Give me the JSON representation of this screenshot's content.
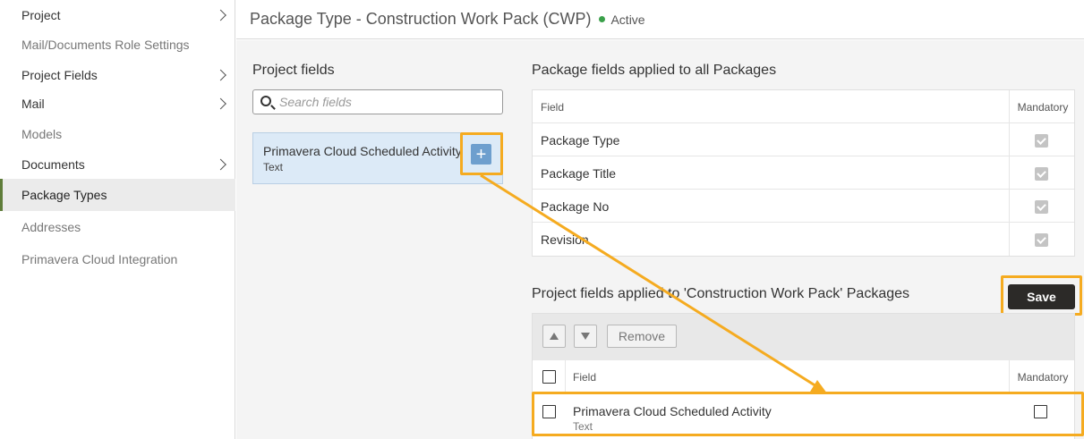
{
  "sidebar": {
    "items": [
      {
        "label": "Project",
        "chevron": true,
        "style": "dark"
      },
      {
        "label": "Mail/Documents Role Settings",
        "chevron": false,
        "style": "muted"
      },
      {
        "label": "Project Fields",
        "chevron": true,
        "style": "dark"
      },
      {
        "label": "Mail",
        "chevron": true,
        "style": "dark"
      },
      {
        "label": "Models",
        "chevron": false,
        "style": "muted"
      },
      {
        "label": "Documents",
        "chevron": true,
        "style": "dark"
      },
      {
        "label": "Package Types",
        "chevron": false,
        "style": "active"
      },
      {
        "label": "Addresses",
        "chevron": false,
        "style": "muted"
      },
      {
        "label": "Primavera Cloud Integration",
        "chevron": false,
        "style": "muted"
      }
    ]
  },
  "header": {
    "title": "Package Type - Construction Work Pack (CWP)",
    "status": "Active",
    "status_color": "#3aa04a"
  },
  "project_fields": {
    "title": "Project fields",
    "search_placeholder": "Search fields",
    "search_value": "",
    "items": [
      {
        "name": "Primavera Cloud Scheduled Activity",
        "type": "Text",
        "add_label": "+"
      }
    ]
  },
  "all_packages": {
    "title": "Package fields applied to all Packages",
    "col_field": "Field",
    "col_mandatory": "Mandatory",
    "rows": [
      {
        "field": "Package Type",
        "mandatory": true
      },
      {
        "field": "Package Title",
        "mandatory": true
      },
      {
        "field": "Package No",
        "mandatory": true
      },
      {
        "field": "Revision",
        "mandatory": true
      }
    ]
  },
  "cwp_packages": {
    "title": "Project fields applied to 'Construction Work Pack' Packages",
    "save_label": "Save",
    "remove_label": "Remove",
    "col_field": "Field",
    "col_mandatory": "Mandatory",
    "rows": [
      {
        "name": "Primavera Cloud Scheduled Activity",
        "type": "Text",
        "selected": false,
        "mandatory": false
      }
    ]
  },
  "colors": {
    "highlight": "#f5ab20",
    "save_bg": "#2c2a28",
    "add_button": "#6e9fce",
    "active_nav_border": "#5f7d3a"
  }
}
